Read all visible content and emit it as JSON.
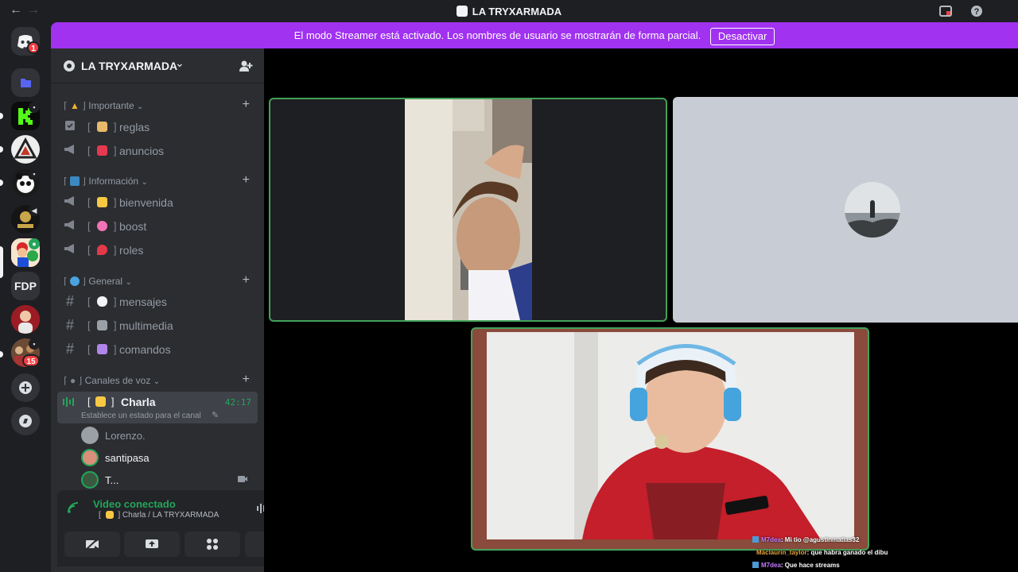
{
  "window": {
    "title": "LA TRYXARMADA",
    "back_icon": "←",
    "forward_icon": "→"
  },
  "banner": {
    "text": "El modo Streamer está activado. Los nombres de usuario se mostrarán de forma parcial.",
    "button": "Desactivar",
    "color": "#a032f0"
  },
  "rail": {
    "home_badge": "1",
    "fdp_label": "FDP",
    "last_badge": "15",
    "add_icon": "+",
    "explore_icon": "compass"
  },
  "server": {
    "name": "LA TRYXARMADA",
    "chevron": "⌄"
  },
  "categories": [
    {
      "label": "Importante",
      "channels": [
        {
          "label": "reglas",
          "icon": "rules-checkbox"
        },
        {
          "label": "anuncios",
          "icon": "megaphone"
        }
      ]
    },
    {
      "label": "Información",
      "channels": [
        {
          "label": "bienvenida",
          "icon": "megaphone"
        },
        {
          "label": "boost",
          "icon": "megaphone"
        },
        {
          "label": "roles",
          "icon": "megaphone"
        }
      ]
    },
    {
      "label": "General",
      "channels": [
        {
          "label": "mensajes",
          "icon": "hash"
        },
        {
          "label": "multimedia",
          "icon": "hash"
        },
        {
          "label": "comandos",
          "icon": "hash"
        }
      ]
    },
    {
      "label": "Canales de voz"
    }
  ],
  "voice_channel": {
    "name": "Charla",
    "timer": "42:17",
    "status": "Establece un estado para el canal",
    "users": [
      "Lorenzo.",
      "santipasa",
      "T..."
    ]
  },
  "voice_panel": {
    "title": "Video conectado",
    "subtitle": "Charla / LA TRYXARMADA"
  },
  "chat": [
    {
      "user": "M7dea",
      "text": ": Mi tio @agustinmatias32",
      "color": "#c67bff"
    },
    {
      "user": "Maclaurin_taylor",
      "text": ": que habra ganado el dibu",
      "color": "#e8a33d"
    },
    {
      "user": "M7dea",
      "text": ": Que hace streams",
      "color": "#c67bff"
    }
  ],
  "colors": {
    "speaking": "#43a25a",
    "voice_green": "#23a55a",
    "background": "#2b2d31"
  }
}
